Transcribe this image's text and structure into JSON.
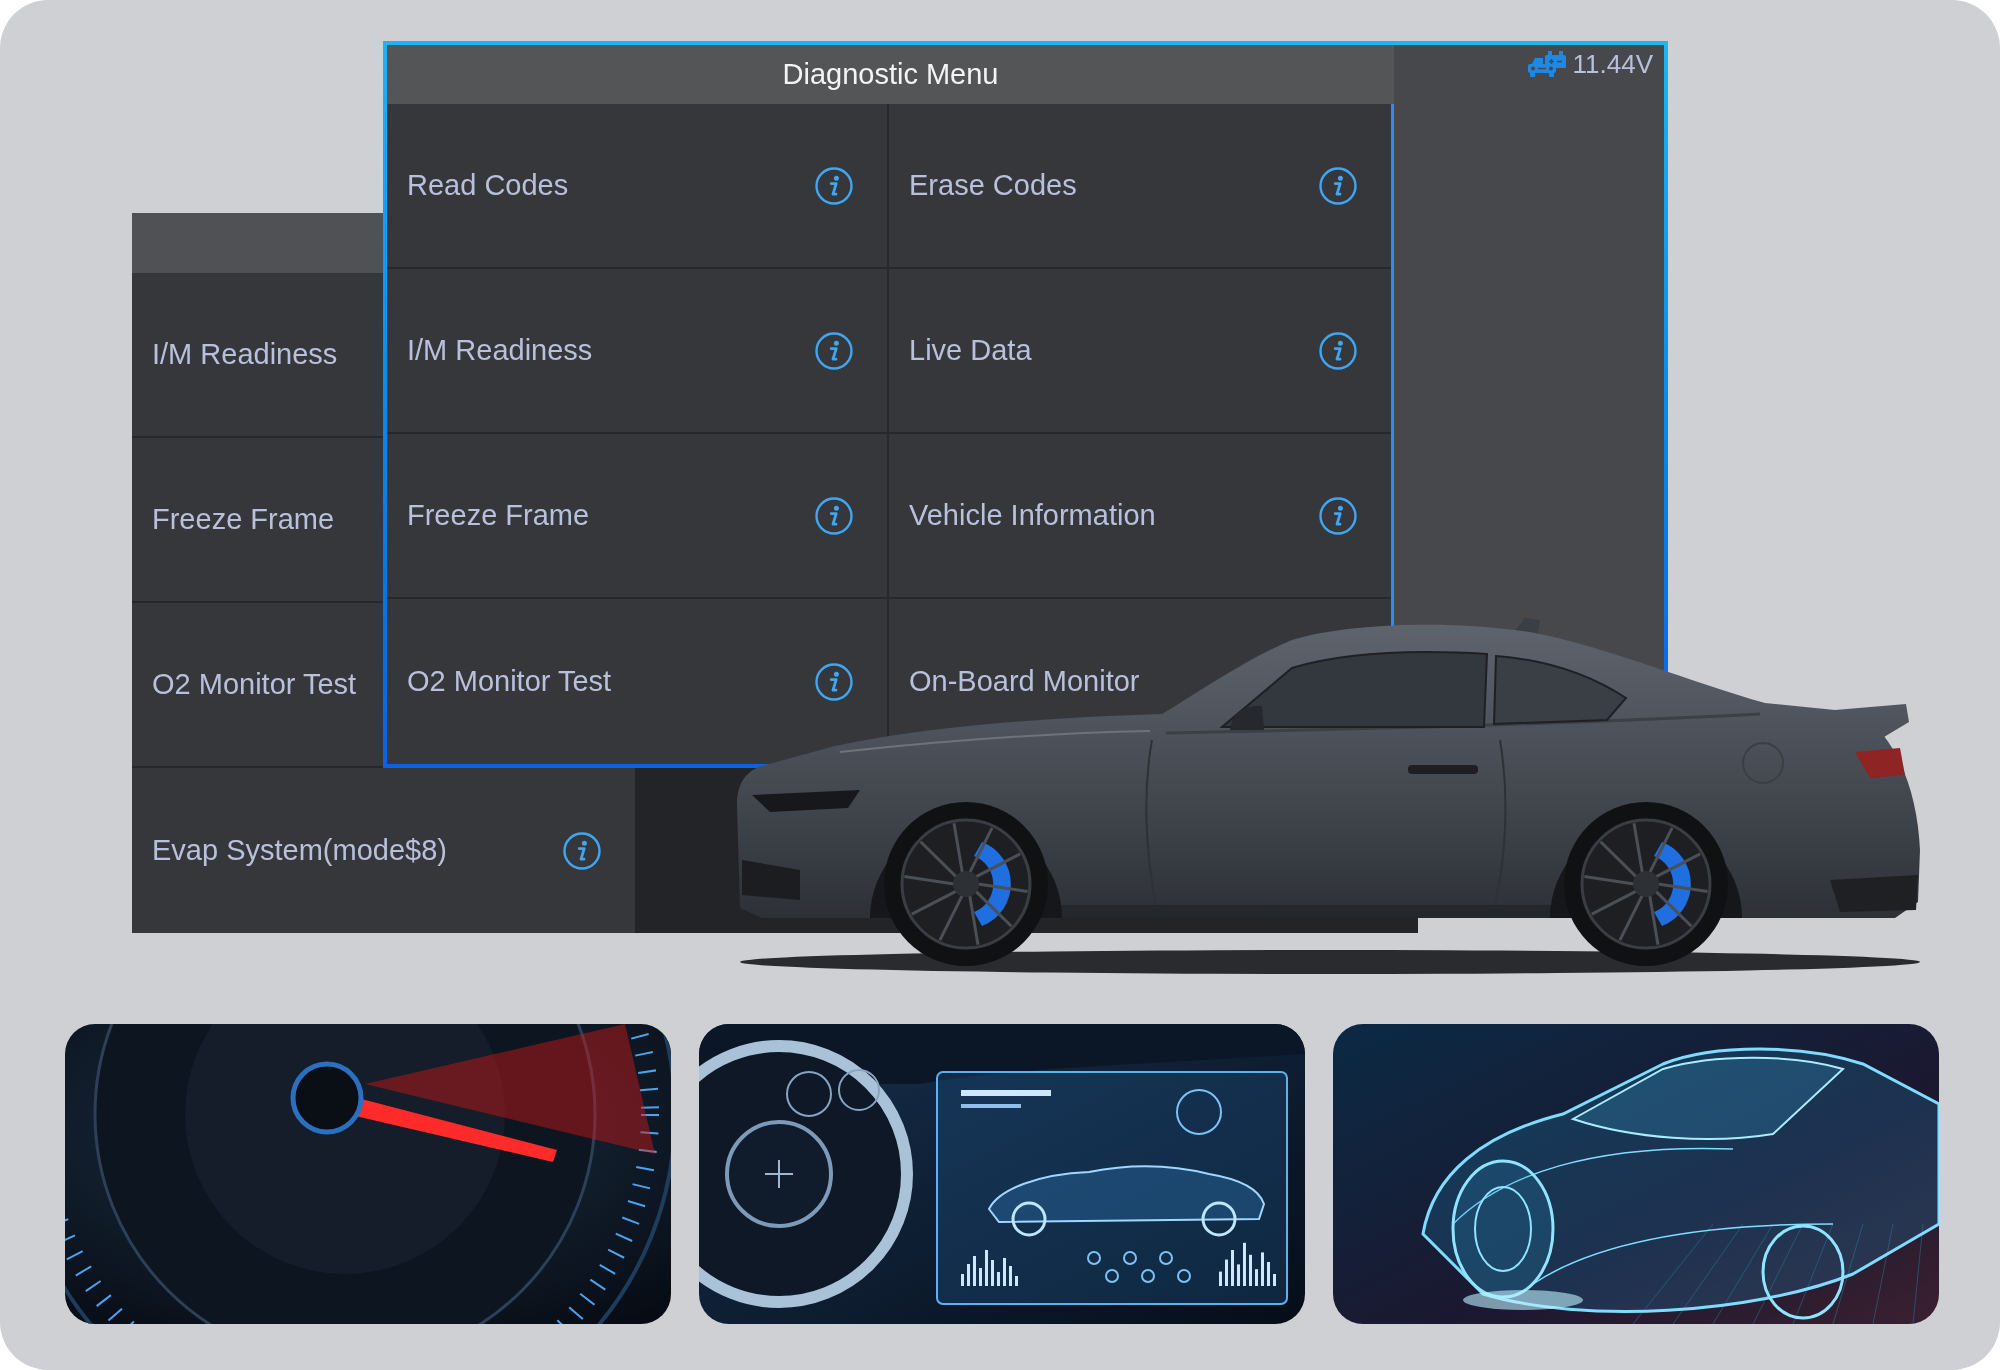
{
  "back_screen": {
    "items": [
      {
        "label": "I/M Readiness",
        "info": false
      },
      {
        "label": "Freeze Frame",
        "info": false
      },
      {
        "label": "O2 Monitor Test",
        "info": false
      },
      {
        "label": "Evap System(mode$8)",
        "info": true
      }
    ]
  },
  "front_screen": {
    "title": "Diagnostic Menu",
    "voltage": "11.44V",
    "items": [
      {
        "label": "Read Codes",
        "info": true
      },
      {
        "label": "Erase Codes",
        "info": true
      },
      {
        "label": "I/M Readiness",
        "info": true
      },
      {
        "label": "Live Data",
        "info": true
      },
      {
        "label": "Freeze Frame",
        "info": true
      },
      {
        "label": "Vehicle Information",
        "info": true
      },
      {
        "label": "O2 Monitor Test",
        "info": true
      },
      {
        "label": "On-Board Monitor",
        "info": false
      }
    ]
  }
}
